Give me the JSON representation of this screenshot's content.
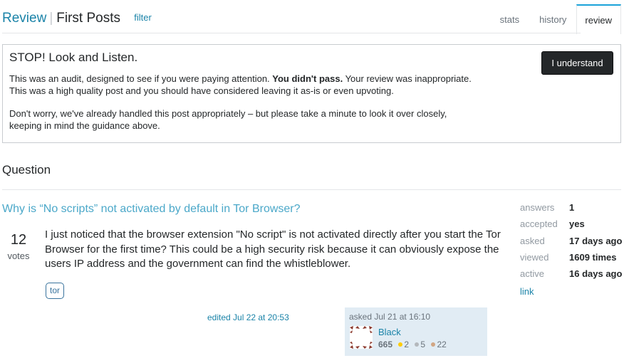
{
  "header": {
    "review_label": "Review",
    "separator": "|",
    "queue_name": "First Posts",
    "filter_label": "filter",
    "tabs": [
      {
        "label": "stats",
        "active": false
      },
      {
        "label": "history",
        "active": false
      },
      {
        "label": "review",
        "active": true
      }
    ],
    "accent_color": "#1aa2d9"
  },
  "audit": {
    "title": "STOP! Look and Listen.",
    "p1_a": "This was an audit, designed to see if you were paying attention. ",
    "p1_bold": "You didn't pass.",
    "p1_b": " Your review was inappropriate.",
    "p1_c": "This was a high quality post and you should have considered leaving it as-is or even upvoting.",
    "p2_a": "Don't worry, we've already handled this post appropriately – but please take a minute to look it over closely,",
    "p2_b": "keeping in mind the guidance above.",
    "button_label": "I understand"
  },
  "section": {
    "title": "Question"
  },
  "question": {
    "title": "Why is “No scripts” not activated by default in Tor Browser?",
    "votes": "12",
    "votes_label": "votes",
    "body": "I just noticed that the browser extension \"No script\" is not activated directly after you start the Tor Browser for the first time? This could be a high security risk because it can obviously expose the users IP address and the government can find the whistleblower.",
    "tags": [
      "tor"
    ],
    "edited": "edited Jul 22 at 20:53",
    "owner": {
      "asked": "asked Jul 21 at 16:10",
      "name": "Black",
      "reputation": "665",
      "gold": "2",
      "silver": "5",
      "bronze": "22",
      "gold_color": "#ffcc01",
      "silver_color": "#b4b8bc",
      "bronze_color": "#d1a684"
    }
  },
  "stats": {
    "rows": [
      {
        "key": "answers",
        "value": "1"
      },
      {
        "key": "accepted",
        "value": "yes"
      },
      {
        "key": "asked",
        "value": "17 days ago"
      },
      {
        "key": "viewed",
        "value": "1609 times"
      },
      {
        "key": "active",
        "value": "16 days ago"
      }
    ],
    "link_label": "link"
  }
}
